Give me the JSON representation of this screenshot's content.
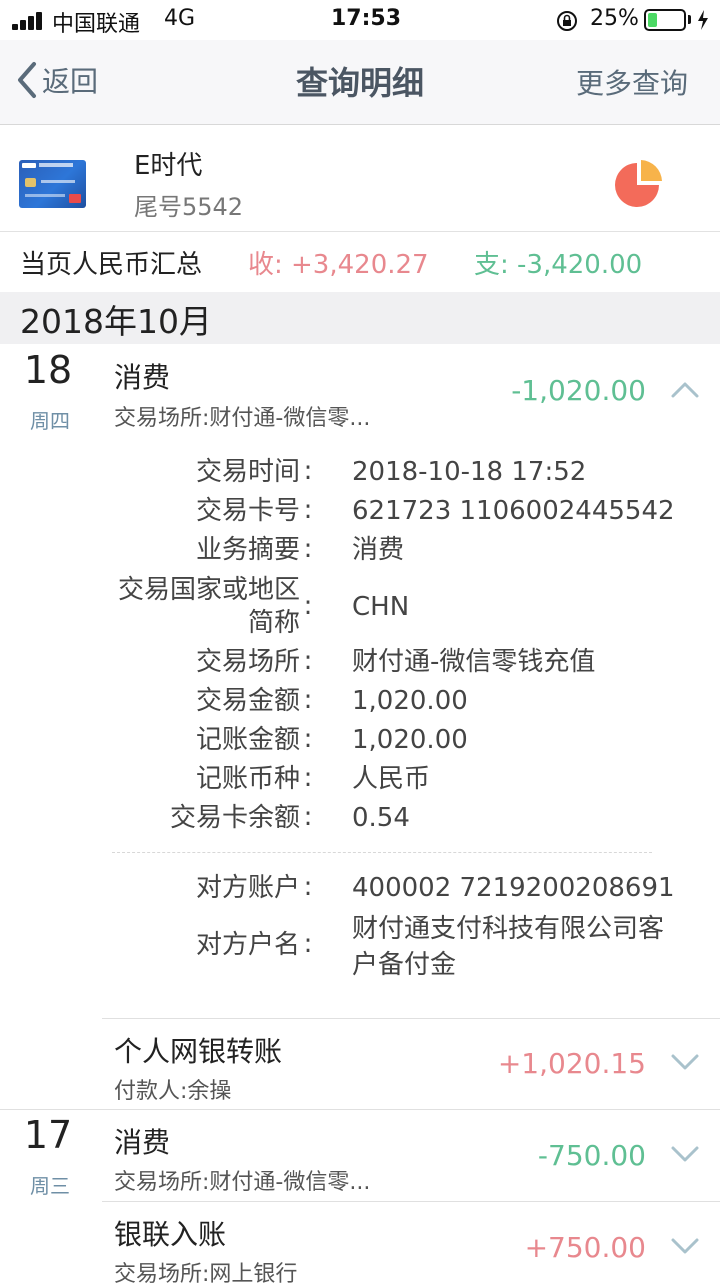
{
  "status_bar": {
    "carrier": "中国联通",
    "network": "4G",
    "time": "17:53",
    "battery": "25%",
    "battery_level": 0.25
  },
  "nav": {
    "back_label": "返回",
    "title": "查询明细",
    "more_label": "更多查询"
  },
  "card": {
    "name": "E时代",
    "number": "尾号5542"
  },
  "summary": {
    "label": "当页人民币汇总",
    "income": "收: +3,420.27",
    "expense": "支: -3,420.00"
  },
  "month": "2018年10月",
  "colors": {
    "expense_green": "#5fbf93",
    "income_red": "#e8888e",
    "nav_text": "#5a6b7a"
  },
  "days": [
    {
      "day": "18",
      "weekday": "周四"
    },
    {
      "day": "17",
      "weekday": "周三"
    }
  ],
  "transactions": [
    {
      "title": "消费",
      "subtitle": "交易场所:财付通-微信零...",
      "amount": "-1,020.00",
      "expanded": true
    },
    {
      "title": "个人网银转账",
      "subtitle": "付款人:余操",
      "amount": "+1,020.15",
      "expanded": false
    },
    {
      "title": "消费",
      "subtitle": "交易场所:财付通-微信零...",
      "amount": "-750.00",
      "expanded": false
    },
    {
      "title": "银联入账",
      "subtitle": "交易场所:网上银行",
      "amount": "+750.00",
      "expanded": false
    }
  ],
  "detail": {
    "rows": [
      {
        "label": "交易时间",
        "value": "2018-10-18 17:52"
      },
      {
        "label": "交易卡号",
        "value": "621723 1106002445542"
      },
      {
        "label": "业务摘要",
        "value": "消费"
      },
      {
        "label": "交易国家或地区简称",
        "value": "CHN"
      },
      {
        "label": "交易场所",
        "value": "财付通-微信零钱充值"
      },
      {
        "label": "交易金额",
        "value": "1,020.00"
      },
      {
        "label": "记账金额",
        "value": "1,020.00"
      },
      {
        "label": "记账币种",
        "value": "人民币"
      },
      {
        "label": "交易卡余额",
        "value": "0.54"
      }
    ],
    "counterparty": [
      {
        "label": "对方账户",
        "value": "400002 7219200208691"
      },
      {
        "label": "对方户名",
        "value": "财付通支付科技有限公司客户备付金"
      }
    ]
  }
}
